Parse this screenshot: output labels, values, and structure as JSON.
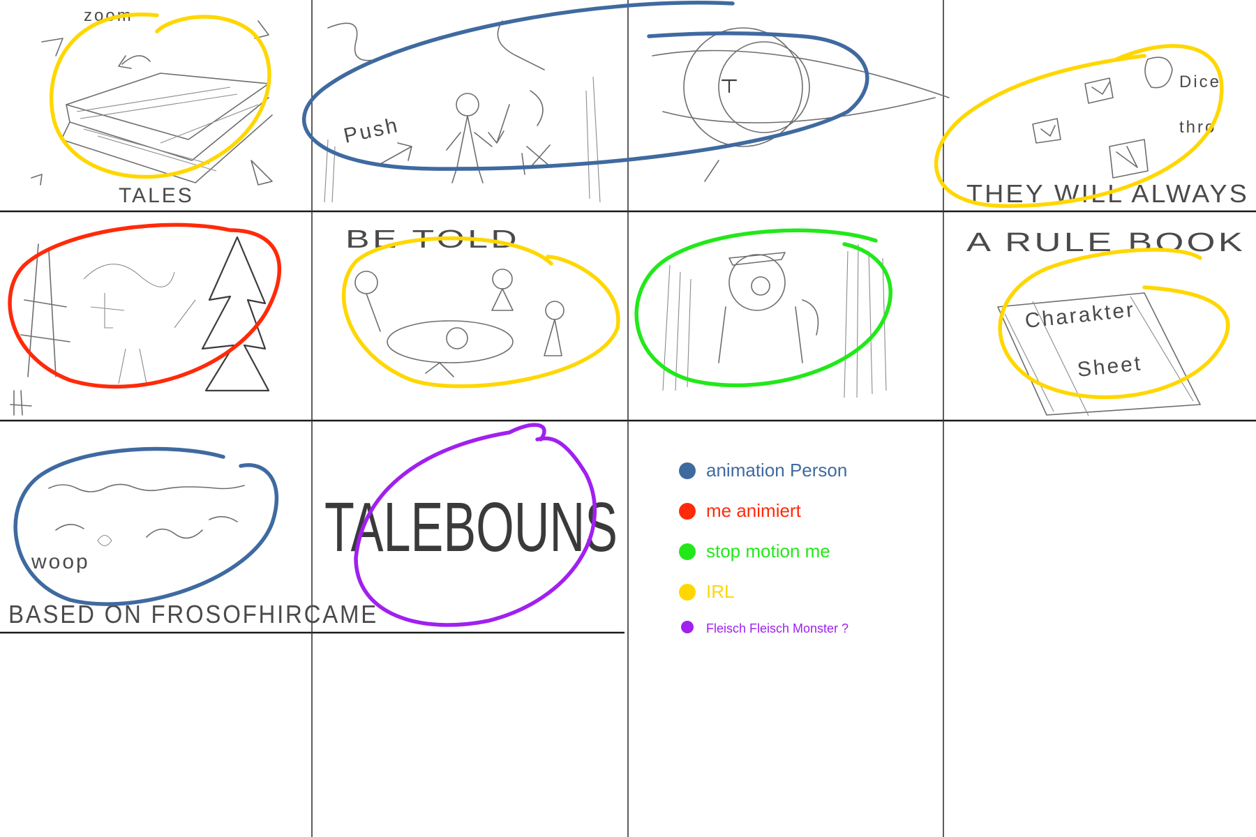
{
  "colors": {
    "animation_person": "#3f6aa0",
    "me_animiert": "#ff2a0a",
    "stop_motion_me": "#22e81a",
    "irl": "#ffd700",
    "fleisch": "#a020f0"
  },
  "panels": {
    "p1": {
      "caption": "TALES",
      "note": "zoom"
    },
    "p2": {
      "note": "Push"
    },
    "p4": {
      "caption": "THEY WILL ALWAYS",
      "note_dice": "Dice",
      "note_throw": "thro"
    },
    "p6": {
      "caption": "BE TOLD"
    },
    "p8": {
      "caption": "A RULE BOOK",
      "sheet_line1": "Charakter",
      "sheet_line2": "Sheet"
    },
    "p9": {
      "caption": "BASED ON FROSOFHIRCAME",
      "note": "woop"
    },
    "p10": {
      "title": "TALEBOUNS"
    }
  },
  "legend": [
    {
      "label": "animation Person",
      "color": "#3f6aa0"
    },
    {
      "label": "me animiert",
      "color": "#ff2a0a"
    },
    {
      "label": "stop motion me",
      "color": "#22e81a"
    },
    {
      "label": "IRL",
      "color": "#ffd700"
    },
    {
      "label": "Fleisch Fleisch Monster ?",
      "color": "#a020f0"
    }
  ]
}
